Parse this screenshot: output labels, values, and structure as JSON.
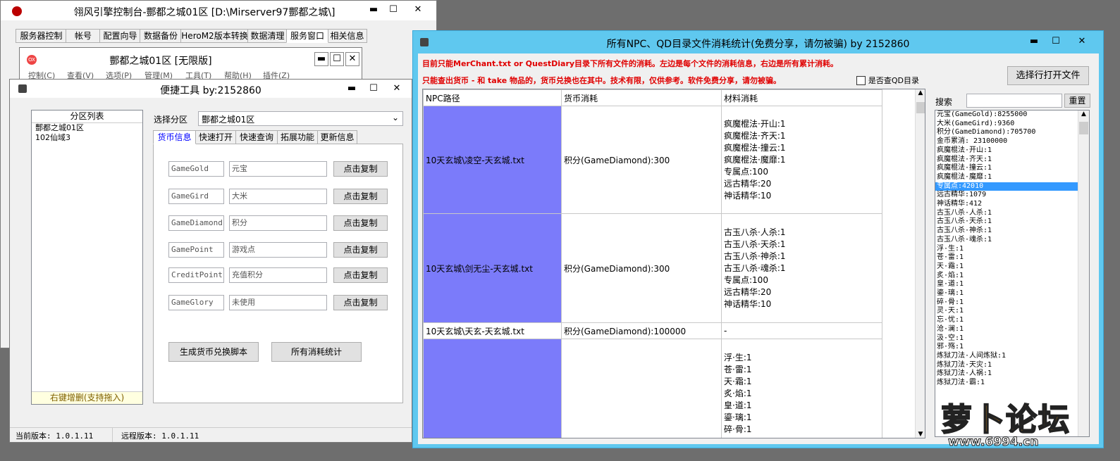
{
  "console": {
    "title": "翎风引擎控制台-酆都之城01区 [D:\\Mirserver97酆都之城\\]",
    "tabs": [
      "服务器控制",
      "帐号",
      "配置向导",
      "数据备份",
      "HeroM2版本转换",
      "数据清理",
      "服务窗口",
      "相关信息"
    ],
    "active_tab": 6
  },
  "inner": {
    "title": "酆都之城01区 [无限版]",
    "menu": [
      "控制(C)",
      "查看(V)",
      "选项(P)",
      "管理(M)",
      "工具(T)",
      "帮助(H)",
      "插件(Z)"
    ]
  },
  "tool": {
    "title": "便捷工具  by:2152860",
    "partition_header": "分区列表",
    "partitions": [
      "酆都之城01区",
      "102仙域3"
    ],
    "partition_footer": "右键增删(支持拖入)",
    "select_label": "选择分区",
    "select_value": "酆都之城01区",
    "tabs": [
      "货币信息",
      "快速打开",
      "快速查询",
      "拓展功能",
      "更新信息"
    ],
    "currencies": [
      {
        "code": "GameGold",
        "name": "元宝",
        "btn": "点击复制"
      },
      {
        "code": "GameGird",
        "name": "大米",
        "btn": "点击复制"
      },
      {
        "code": "GameDiamond",
        "name": "积分",
        "btn": "点击复制"
      },
      {
        "code": "GamePoint",
        "name": "游戏点",
        "btn": "点击复制"
      },
      {
        "code": "CreditPoint",
        "name": "充值积分",
        "btn": "点击复制"
      },
      {
        "code": "GameGlory",
        "name": "未使用",
        "btn": "点击复制"
      }
    ],
    "gen_button": "生成货币兑换脚本",
    "stats_button": "所有消耗统计",
    "status_current": "当前版本: 1.0.1.11",
    "status_remote": "远程版本: 1.0.1.11"
  },
  "stats": {
    "title": "所有NPC、QD目录文件消耗统计(免费分享，请勿被骗)   by 2152860",
    "notice1": "目前只能MerChant.txt or QuestDiary目录下所有文件的消耗。左边是每个文件的消耗信息，右边是所有累计消耗。",
    "notice2": "只能查出货币 - 和 take 物品的，货币兑换也在其中。技术有限，仅供参考。软件免费分享，请勿被骗。",
    "checkbox_label": "是否查QD目录",
    "open_button": "选择行打开文件",
    "search_label": "搜索",
    "reset_button": "重置",
    "columns": [
      "NPC路径",
      "货币消耗",
      "材料消耗"
    ],
    "rows": [
      {
        "path": "10天玄城\\凌空-天玄城.txt",
        "currency": "积分(GameDiamond):300",
        "materials": [
          "疯魔棍法·开山:1",
          "疯魔棍法·齐天:1",
          "疯魔棍法·撞云:1",
          "疯魔棍法·魔靡:1",
          "专属点:100",
          "远古精华:20",
          "神话精华:10"
        ]
      },
      {
        "path": "10天玄城\\剑无尘-天玄城.txt",
        "currency": "积分(GameDiamond):300",
        "materials": [
          "古玉八杀·人杀:1",
          "古玉八杀·天杀:1",
          "古玉八杀·神杀:1",
          "古玉八杀·魂杀:1",
          "专属点:100",
          "远古精华:20",
          "神话精华:10"
        ]
      },
      {
        "path": "10天玄城\\天玄-天玄城.txt",
        "currency": "积分(GameDiamond):100000",
        "materials": [
          "-"
        ]
      },
      {
        "path": "",
        "currency": "",
        "materials": [
          "浮·生:1",
          "苍·雷:1",
          "天·霜:1",
          "炙·焰:1",
          "皇·道:1",
          "鎏·璃:1",
          "碎·骨:1"
        ]
      }
    ],
    "totals": [
      "元宝(GameGold):8255000",
      "大米(GameGird):9360",
      "积分(GameDiamond):705700",
      "金币累消: 23100000",
      "疯魔棍法·开山:1",
      "疯魔棍法·齐天:1",
      "疯魔棍法·撞云:1",
      "疯魔棍法·魔靡:1",
      "专属点:42010",
      "远古精华:1079",
      "神话精华:412",
      "古玉八杀·人杀:1",
      "古玉八杀·天杀:1",
      "古玉八杀·神杀:1",
      "古玉八杀·魂杀:1",
      "浮·生:1",
      "苍·雷:1",
      "天·霜:1",
      "炙·焰:1",
      "皇·道:1",
      "鎏·璃:1",
      "碎·骨:1",
      "灵·天:1",
      "忘·忧:1",
      "沧·澜:1",
      "汲·空:1",
      "邪·殇:1",
      "炼狱刀法·人间炼狱:1",
      "炼狱刀法·天灾:1",
      "炼狱刀法·人祸:1",
      "炼狱刀法·霸:1"
    ],
    "totals_selected": 8
  },
  "watermark": {
    "text": "萝卜论坛",
    "url": "www.6994.cn"
  },
  "colors": {
    "accent": "#5fc8ef",
    "path_cell": "#7b7bfa",
    "notice": "#e00000"
  }
}
